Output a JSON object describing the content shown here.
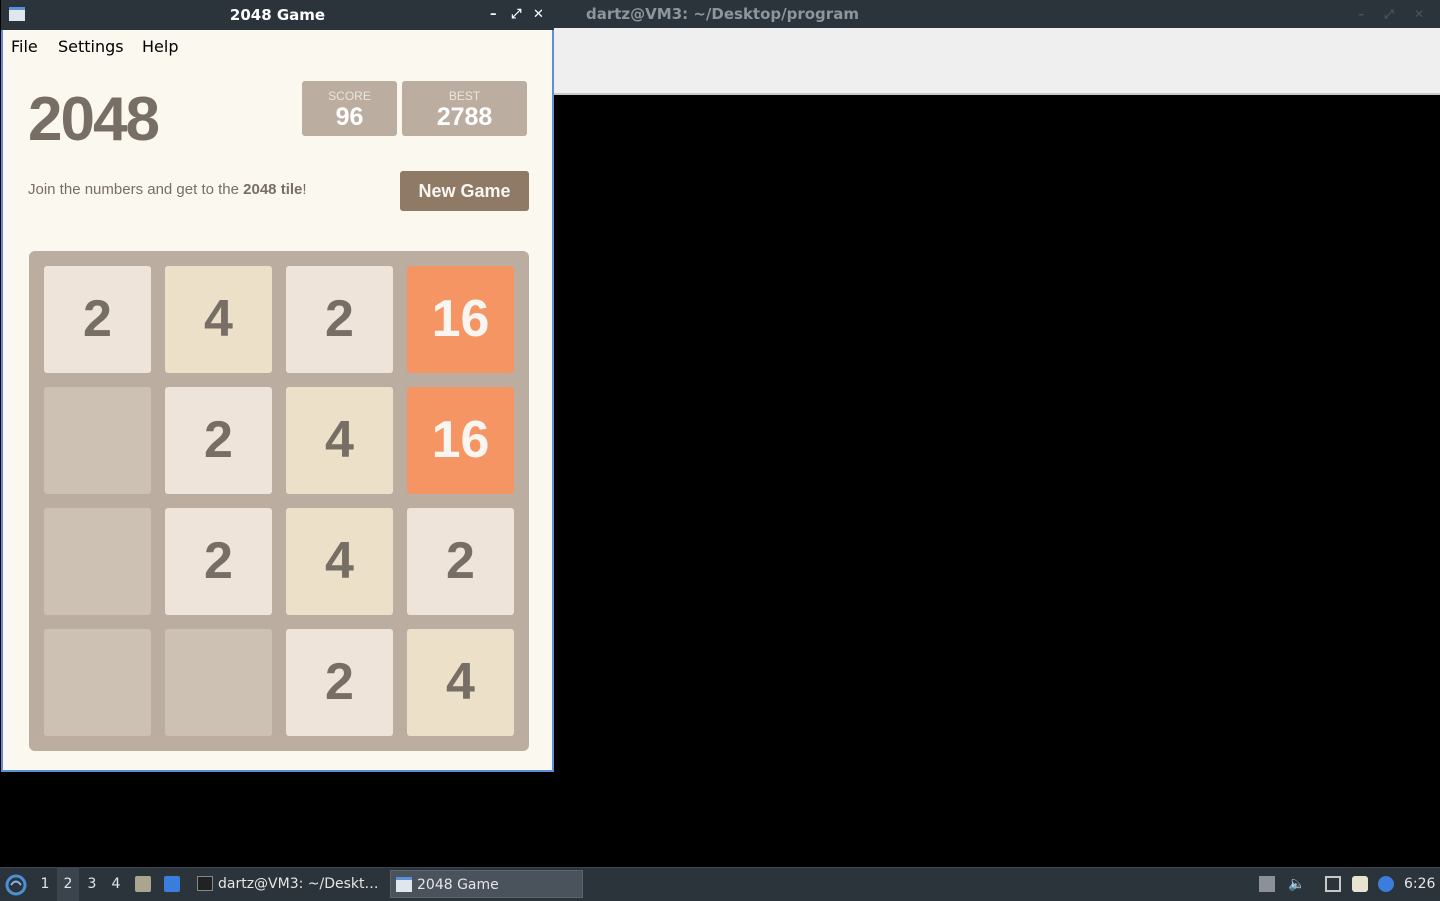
{
  "terminal_window": {
    "title": "dartz@VM3: ~/Desktop/program"
  },
  "game_window": {
    "title": "2048 Game",
    "menu": [
      "File",
      "Settings",
      "Help"
    ],
    "logo": "2048",
    "score": {
      "label": "SCORE",
      "value": "96"
    },
    "best": {
      "label": "BEST",
      "value": "2788"
    },
    "intro": {
      "prefix": "Join the numbers and get to the ",
      "bold": "2048 tile",
      "suffix": "!"
    },
    "new_game_label": "New Game",
    "board": [
      [
        "2",
        "4",
        "2",
        "16"
      ],
      [
        "",
        "2",
        "4",
        "16"
      ],
      [
        "",
        "2",
        "4",
        "2"
      ],
      [
        "",
        "",
        "2",
        "4"
      ]
    ]
  },
  "taskbar": {
    "workspaces": [
      "1",
      "2",
      "3",
      "4"
    ],
    "active_workspace": "2",
    "tasks": [
      {
        "label": "dartz@VM3: ~/Deskt…",
        "icon": "terminal-icon"
      },
      {
        "label": "2048 Game",
        "icon": "window-icon"
      }
    ],
    "clock": "6:26"
  }
}
